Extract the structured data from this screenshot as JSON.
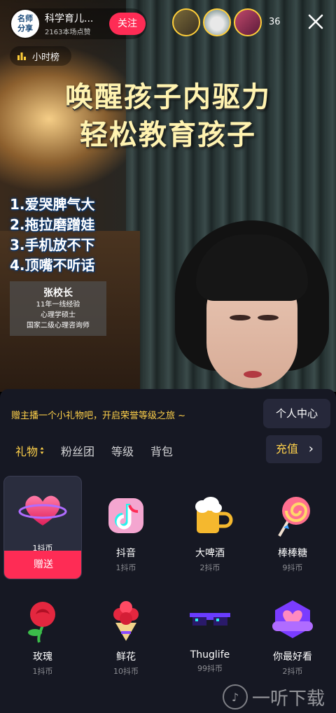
{
  "host": {
    "avatar_text": "名师分享",
    "name": "科学育儿...",
    "likes": "2163本场点赞",
    "follow_label": "关注"
  },
  "viewers": {
    "count": "36"
  },
  "rank": {
    "label": "小时榜"
  },
  "video": {
    "headline_1": "唤醒孩子内驱力",
    "headline_2": "轻松教育孩子",
    "bullets": [
      "1.爱哭脾气大",
      "2.拖拉磨蹭娃",
      "3.手机放不下",
      "4.顶嘴不听话"
    ],
    "credential": {
      "name": "张校长",
      "lines": [
        "11年一线经验",
        "心理学硕士",
        "国家二级心理咨询师"
      ]
    }
  },
  "panel": {
    "promo": "赠主播一个小礼物吧，开启荣誉等级之旅 ~",
    "personal_center": "个人中心",
    "tabs": [
      "礼物",
      "粉丝团",
      "等级",
      "背包"
    ],
    "recharge": "充值",
    "send_label": "赠送",
    "gifts": [
      {
        "name": "",
        "price": "1抖币",
        "icon": "heart-ring-icon",
        "selected": true
      },
      {
        "name": "抖音",
        "price": "1抖币",
        "icon": "douyin-logo-icon"
      },
      {
        "name": "大啤酒",
        "price": "2抖币",
        "icon": "beer-mug-icon"
      },
      {
        "name": "棒棒糖",
        "price": "9抖币",
        "icon": "lollipop-icon"
      },
      {
        "name": "玫瑰",
        "price": "1抖币",
        "icon": "rose-icon"
      },
      {
        "name": "鲜花",
        "price": "10抖币",
        "icon": "bouquet-icon"
      },
      {
        "name": "Thuglife",
        "price": "99抖币",
        "icon": "pixel-sunglasses-icon"
      },
      {
        "name": "你最好看",
        "price": "2抖币",
        "icon": "you-look-best-badge-icon"
      }
    ]
  },
  "watermark": {
    "text": "一听下载"
  }
}
